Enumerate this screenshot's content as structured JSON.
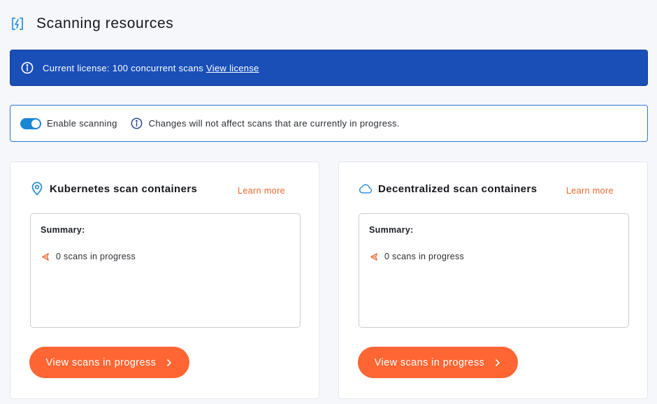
{
  "header": {
    "title": "Scanning resources",
    "icon": "lightning-bolt-icon"
  },
  "banner": {
    "text": "Current license: 100 concurrent scans",
    "link_label": "View license",
    "background": "#1a4fb8"
  },
  "scanning": {
    "toggle_label": "Enable scanning",
    "enabled": true,
    "note": "Changes will not affect scans that are currently in progress."
  },
  "cards": [
    {
      "title": "Kubernetes scan containers",
      "icon": "location-pin-icon",
      "learn_more": "Learn more",
      "summary_label": "Summary:",
      "scans_text": "0 scans in progress",
      "button_label": "View scans in progress"
    },
    {
      "title": "Decentralized scan containers",
      "icon": "cloud-icon",
      "learn_more": "Learn more",
      "summary_label": "Summary:",
      "scans_text": "0 scans in progress",
      "button_label": "View scans in progress"
    }
  ],
  "colors": {
    "accent": "#1a86d6",
    "cta": "#ff6633",
    "link_orange": "#f0642c"
  }
}
